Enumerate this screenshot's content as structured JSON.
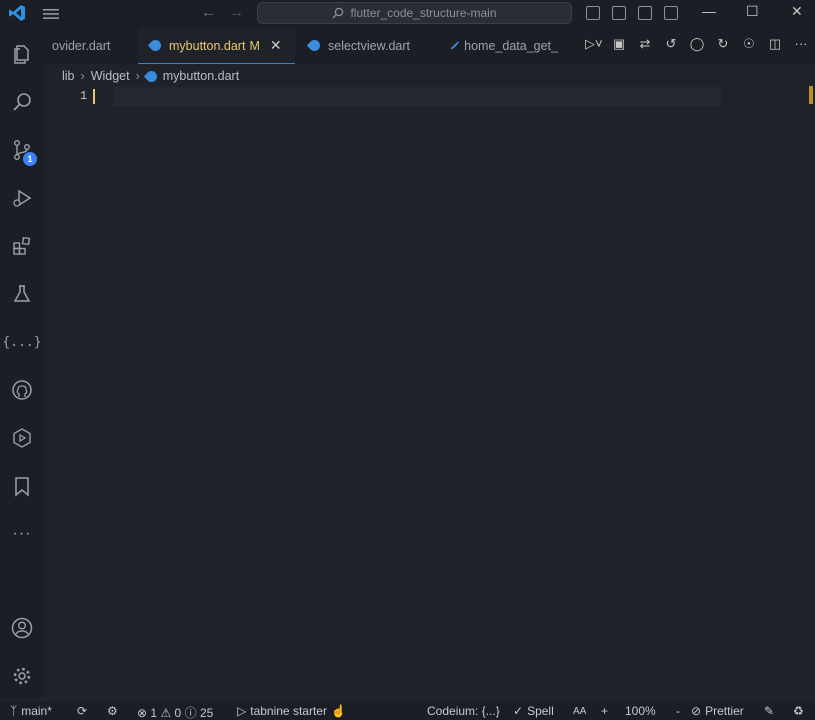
{
  "titlebar": {
    "search_text": "flutter_code_structure-main"
  },
  "activity_bar": {
    "scm_badge": "1",
    "items": [
      "explorer",
      "search",
      "source-control",
      "run-debug",
      "extensions",
      "testing",
      "json",
      "github",
      "copilot",
      "bookmarks",
      "more",
      "accounts",
      "manage"
    ]
  },
  "tabs": [
    {
      "label": "ovider.dart",
      "active": false
    },
    {
      "label": "mybutton.dart",
      "active": true,
      "modified": "M"
    },
    {
      "label": "selectview.dart",
      "active": false
    },
    {
      "label": "home_data_get_",
      "active": false
    }
  ],
  "breadcrumb": {
    "parts": [
      "lib",
      "Widget",
      "mybutton.dart"
    ]
  },
  "editor": {
    "line_number": "1"
  },
  "statusbar": {
    "branch": "main*",
    "errors": "1",
    "warnings": "0",
    "infos": "25",
    "tabnine": "tabnine starter",
    "codeium": "Codeium: {...}",
    "spell": "Spell",
    "aa": "AA",
    "plus": "+",
    "zoom": "100%",
    "minus": "-",
    "prettier": "Prettier"
  },
  "colors": {
    "accent": "#3f7fd1",
    "modified": "#e7c86e",
    "badge": "#3b82f6"
  }
}
